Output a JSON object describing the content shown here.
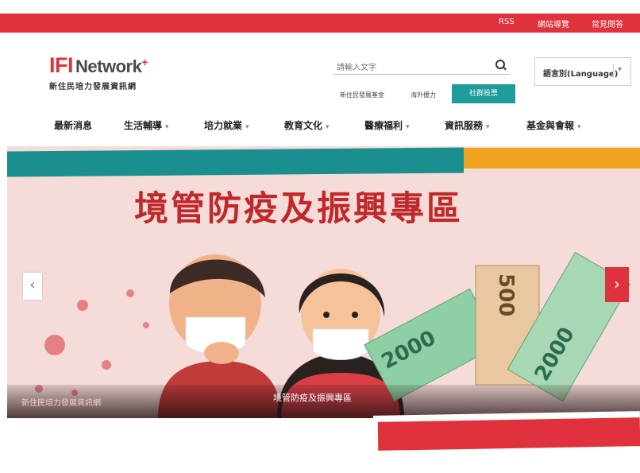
{
  "topbar": {
    "links": [
      "RSS",
      "網站導覽",
      "常見問答"
    ]
  },
  "logo": {
    "main_i": "I",
    "main_f": "F",
    "main_bar": "I",
    "main_net": "Network",
    "plus": "+",
    "subtitle": "新住民培力發展資訊網"
  },
  "search": {
    "placeholder": "請輸入文字"
  },
  "quick_links": [
    "新住民發展基金",
    "海外援力"
  ],
  "quick_button": "社群投票",
  "language": {
    "label": "語言別(Language)",
    "caret": "▾"
  },
  "nav": [
    {
      "label": "最新消息",
      "caret": ""
    },
    {
      "label": "生活輔導",
      "caret": "▾"
    },
    {
      "label": "培力就業",
      "caret": "▾"
    },
    {
      "label": "教育文化",
      "caret": "▾"
    },
    {
      "label": "醫療福利",
      "caret": "▾"
    },
    {
      "label": "資訊服務",
      "caret": "▾"
    },
    {
      "label": "基金與會報",
      "caret": "▾"
    }
  ],
  "banner": {
    "title": "境管防疫及振興專區",
    "caption_left": "新住民培力發展資訊網",
    "caption_center": "境管防疫及振興專區",
    "prev": "‹",
    "next": "›"
  },
  "colors": {
    "brand_red": "#e0323c",
    "teal": "#1f9b9b",
    "orange": "#f0a31e",
    "hero_bg": "#f5dcd8"
  }
}
